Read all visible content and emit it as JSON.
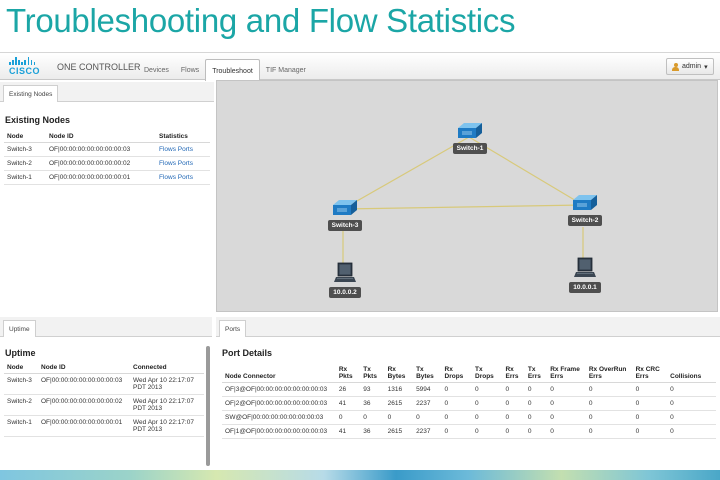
{
  "slide_title": "Troubleshooting and Flow Statistics",
  "brand": {
    "logo_text": "CISCO",
    "product": "ONE CONTROLLER",
    "accent": "#1ba6a6",
    "logo_color": "#1aa0d8"
  },
  "nav": {
    "tabs": [
      "Devices",
      "Flows",
      "Troubleshoot",
      "TIF Manager"
    ],
    "active": "Troubleshoot"
  },
  "user": {
    "name": "admin",
    "caret": "▾"
  },
  "existing_nodes": {
    "tab": "Existing Nodes",
    "heading": "Existing Nodes",
    "columns": [
      "Node",
      "Node ID",
      "Statistics"
    ],
    "rows": [
      {
        "node": "Switch-3",
        "id": "OF|00:00:00:00:00:00:00:03",
        "flows": "Flows",
        "ports": "Ports"
      },
      {
        "node": "Switch-2",
        "id": "OF|00:00:00:00:00:00:00:02",
        "flows": "Flows",
        "ports": "Ports"
      },
      {
        "node": "Switch-1",
        "id": "OF|00:00:00:00:00:00:00:01",
        "flows": "Flows",
        "ports": "Ports"
      }
    ]
  },
  "topology": {
    "nodes": [
      {
        "label": "Switch-1",
        "kind": "switch"
      },
      {
        "label": "Switch-3",
        "kind": "switch"
      },
      {
        "label": "Switch-2",
        "kind": "switch"
      },
      {
        "label": "10.0.0.2",
        "kind": "host"
      },
      {
        "label": "10.0.0.1",
        "kind": "host"
      }
    ],
    "link_color": "#d8c97a"
  },
  "uptime": {
    "tab": "Uptime",
    "heading": "Uptime",
    "columns": [
      "Node",
      "Node ID",
      "Connected"
    ],
    "rows": [
      {
        "node": "Switch-3",
        "id": "OF|00:00:00:00:00:00:00:03",
        "connected": [
          "Wed Apr 10 22:17:07",
          "PDT 2013"
        ]
      },
      {
        "node": "Switch-2",
        "id": "OF|00:00:00:00:00:00:00:02",
        "connected": [
          "Wed Apr 10 22:17:07",
          "PDT 2013"
        ]
      },
      {
        "node": "Switch-1",
        "id": "OF|00:00:00:00:00:00:00:01",
        "connected": [
          "Wed Apr 10 22:17:07",
          "PDT 2013"
        ]
      }
    ]
  },
  "ports": {
    "tab": "Ports",
    "heading": "Port Details",
    "columns": [
      [
        "Node Connector"
      ],
      [
        "Rx",
        "Pkts"
      ],
      [
        "Tx",
        "Pkts"
      ],
      [
        "Rx",
        "Bytes"
      ],
      [
        "Tx",
        "Bytes"
      ],
      [
        "Rx",
        "Drops"
      ],
      [
        "Tx",
        "Drops"
      ],
      [
        "Rx",
        "Errs"
      ],
      [
        "Tx",
        "Errs"
      ],
      [
        "Rx Frame",
        "Errs"
      ],
      [
        "Rx OverRun",
        "Errs"
      ],
      [
        "Rx CRC",
        "Errs"
      ],
      [
        "Collisions"
      ]
    ],
    "rows": [
      [
        "OF|3@OF|00:00:00:00:00:00:00:03",
        "26",
        "93",
        "1316",
        "5994",
        "0",
        "0",
        "0",
        "0",
        "0",
        "0",
        "0",
        "0"
      ],
      [
        "OF|2@OF|00:00:00:00:00:00:00:03",
        "41",
        "36",
        "2615",
        "2237",
        "0",
        "0",
        "0",
        "0",
        "0",
        "0",
        "0",
        "0"
      ],
      [
        "SW@OF|00:00:00:00:00:00:00:03",
        "0",
        "0",
        "0",
        "0",
        "0",
        "0",
        "0",
        "0",
        "0",
        "0",
        "0",
        "0"
      ],
      [
        "OF|1@OF|00:00:00:00:00:00:00:03",
        "41",
        "36",
        "2615",
        "2237",
        "0",
        "0",
        "0",
        "0",
        "0",
        "0",
        "0",
        "0"
      ]
    ]
  }
}
